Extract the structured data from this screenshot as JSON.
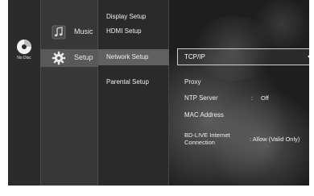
{
  "status": {
    "disc_label": "No Disc"
  },
  "categories": [
    {
      "label": "Music",
      "icon": "music-icon"
    },
    {
      "label": "Setup",
      "icon": "gear-icon",
      "selected": true
    }
  ],
  "setup_menu": {
    "items": [
      "Display Setup",
      "HDMI Setup",
      "Network Setup",
      "Parental Setup"
    ],
    "selected": "Network Setup"
  },
  "network_options": {
    "highlighted": "TCP/IP",
    "proxy": "Proxy",
    "ntp_server": {
      "label": "NTP Server",
      "separator": ":",
      "value": "Off"
    },
    "mac_address": "MAC Address",
    "bd_live": {
      "label_line1": "BD-LIVE Internet",
      "label_line2": "Connection",
      "value": ": Allow (Valid Only)"
    }
  }
}
